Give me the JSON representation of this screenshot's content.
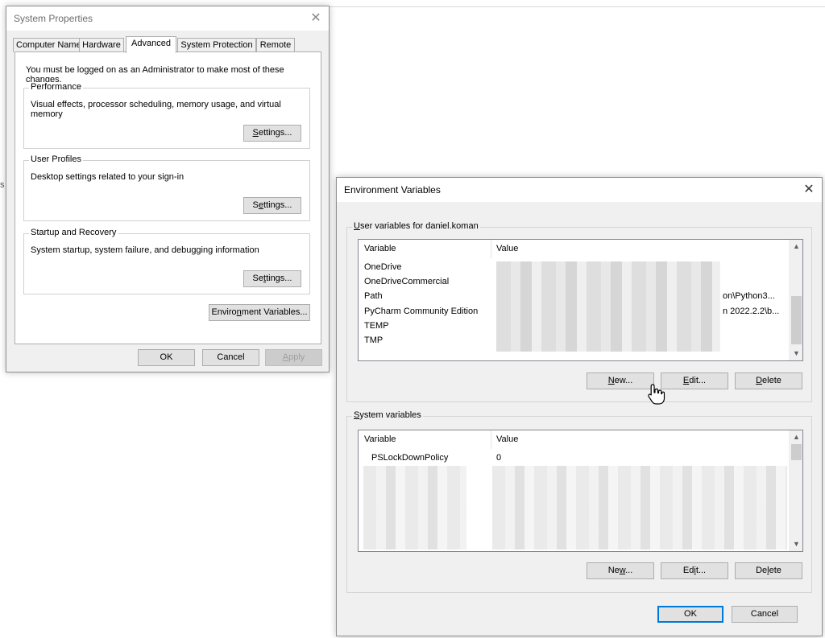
{
  "background_fragment": "s",
  "system_properties": {
    "title": "System Properties",
    "close_glyph": "✕",
    "tabs": [
      {
        "label": "Computer Name"
      },
      {
        "label": "Hardware"
      },
      {
        "label": "Advanced",
        "active": true
      },
      {
        "label": "System Protection"
      },
      {
        "label": "Remote"
      }
    ],
    "note": "You must be logged on as an Administrator to make most of these changes.",
    "performance": {
      "legend": "Performance",
      "desc": "Visual effects, processor scheduling, memory usage, and virtual memory",
      "button": {
        "pre": "",
        "acc": "S",
        "post": "ettings..."
      }
    },
    "user_profiles": {
      "legend": "User Profiles",
      "desc": "Desktop settings related to your sign-in",
      "button": {
        "pre": "S",
        "acc": "e",
        "post": "ttings..."
      }
    },
    "startup_recovery": {
      "legend": "Startup and Recovery",
      "desc": "System startup, system failure, and debugging information",
      "button": {
        "pre": "Se",
        "acc": "t",
        "post": "tings..."
      }
    },
    "env_button": {
      "pre": "Enviro",
      "acc": "n",
      "post": "ment Variables..."
    },
    "ok": "OK",
    "cancel": "Cancel",
    "apply": {
      "pre": "",
      "acc": "A",
      "post": "pply"
    }
  },
  "environment_variables": {
    "title": "Environment Variables",
    "close_glyph": "✕",
    "user_group": {
      "legend": {
        "pre": "",
        "acc": "U",
        "post": "ser variables for daniel.koman"
      },
      "columns": [
        "Variable",
        "Value"
      ],
      "rows": [
        {
          "variable": "OneDrive",
          "value": ""
        },
        {
          "variable": "OneDriveCommercial",
          "value": ""
        },
        {
          "variable": "Path",
          "value": "on\\Python3..."
        },
        {
          "variable": "PyCharm Community Edition",
          "value": "n 2022.2.2\\b..."
        },
        {
          "variable": "TEMP",
          "value": ""
        },
        {
          "variable": "TMP",
          "value": ""
        }
      ],
      "new": {
        "pre": "",
        "acc": "N",
        "post": "ew..."
      },
      "edit": {
        "pre": "",
        "acc": "E",
        "post": "dit..."
      },
      "delete": {
        "pre": "",
        "acc": "D",
        "post": "elete"
      }
    },
    "system_group": {
      "legend": {
        "pre": "",
        "acc": "S",
        "post": "ystem variables"
      },
      "columns": [
        "Variable",
        "Value"
      ],
      "rows": [
        {
          "variable": "PSLockDownPolicy",
          "value": "0"
        }
      ],
      "new": {
        "pre": "Ne",
        "acc": "w",
        "post": "..."
      },
      "edit": {
        "pre": "Ed",
        "acc": "i",
        "post": "t..."
      },
      "delete": {
        "pre": "De",
        "acc": "l",
        "post": "ete"
      }
    },
    "ok": "OK",
    "cancel": "Cancel"
  },
  "scroll_up_glyph": "▲",
  "scroll_down_glyph": "▼"
}
